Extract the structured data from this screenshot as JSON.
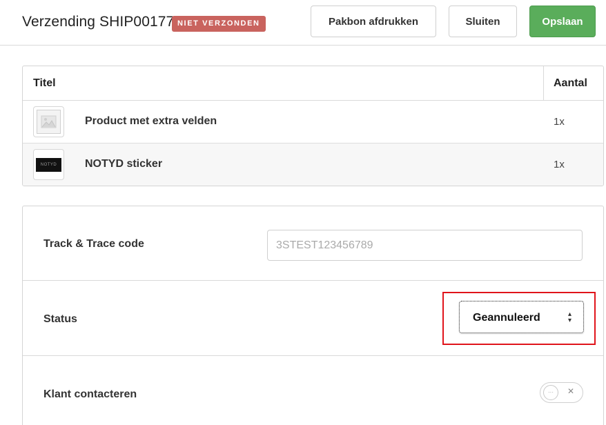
{
  "header": {
    "title": "Verzending SHIP00177",
    "status_badge": "NIET VERZONDEN",
    "buttons": {
      "print_label": "Pakbon afdrukken",
      "close_label": "Sluiten",
      "save_label": "Opslaan"
    },
    "colors": {
      "badge": "#c9635e",
      "save": "#5aad5b"
    }
  },
  "items_table": {
    "columns": [
      "Titel",
      "Aantal"
    ],
    "rows": [
      {
        "title": "Product met extra velden",
        "quantity": "1x",
        "thumbnail": "image-placeholder-icon"
      },
      {
        "title": "NOTYD sticker",
        "quantity": "1x",
        "thumbnail": "notyd-logo",
        "thumbnail_text": "NOTYD"
      }
    ]
  },
  "form": {
    "track_trace": {
      "label": "Track & Trace code",
      "placeholder": "3STEST123456789",
      "value": ""
    },
    "status": {
      "label": "Status",
      "selected": "Geannuleerd",
      "highlight_color": "#e0131a"
    },
    "contact_customer": {
      "label": "Klant contacteren",
      "enabled": false
    }
  }
}
